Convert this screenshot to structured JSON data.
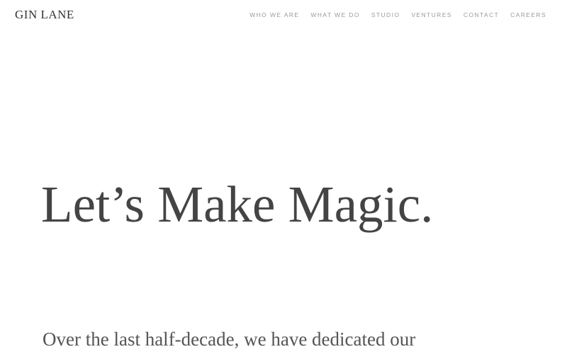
{
  "header": {
    "logo": "GIN LANE",
    "nav": [
      {
        "label": "WHO WE ARE"
      },
      {
        "label": "WHAT WE DO"
      },
      {
        "label": "STUDIO"
      },
      {
        "label": "VENTURES"
      },
      {
        "label": "CONTACT"
      },
      {
        "label": "CAREERS"
      }
    ]
  },
  "hero": {
    "title": "Let’s Make Magic.",
    "intro": "Over the last half-decade, we have dedicated our"
  },
  "colors": {
    "background": "#ffffff",
    "heading": "#444444",
    "nav": "#9a9a9a"
  }
}
